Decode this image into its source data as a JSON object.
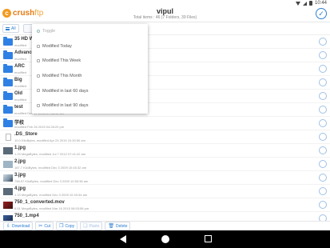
{
  "status_bar": {
    "time": "10:44"
  },
  "header": {
    "logo": {
      "letter": "c",
      "brand": "crush",
      "brand_tail": "ftp"
    },
    "title": "vipul",
    "subtitle": "Total items : 46 (7 Folders, 39 Files)"
  },
  "toolbar": {
    "filter_label": "All"
  },
  "dropdown": {
    "items": [
      {
        "label": "Toggle",
        "kind": "toggle"
      },
      {
        "label": "Modified Today",
        "kind": "option"
      },
      {
        "label": "Modified This Week",
        "kind": "option"
      },
      {
        "label": "Modified This Month",
        "kind": "option"
      },
      {
        "label": "Modified in last 60 days",
        "kind": "option"
      },
      {
        "label": "Modified in last 90 days",
        "kind": "option"
      }
    ]
  },
  "files": [
    {
      "name": "35 HD W",
      "meta": "modified",
      "thumb": "folder"
    },
    {
      "name": "Advance",
      "meta": "modified",
      "thumb": "folder"
    },
    {
      "name": "ARC",
      "meta": "modified",
      "thumb": "folder"
    },
    {
      "name": "Big",
      "meta": "modified",
      "thumb": "folder"
    },
    {
      "name": "Old",
      "meta": "modified",
      "thumb": "folder"
    },
    {
      "name": "test",
      "meta": "modified Dec 17 2015 07:56:42 am",
      "thumb": "folder"
    },
    {
      "name": "学校",
      "meta": "modified Feb 26 2015 04:28:20 pm",
      "thumb": "folder"
    },
    {
      "name": ".DS_Store",
      "meta": "10.0 KiloBytes, modified Apr 24 2015 10:30:50 am",
      "thumb": "doc"
    },
    {
      "name": "1.jpg",
      "meta": "1.23 MegaBytes, modified Jul 7 2012 07:41:42 am",
      "thumb": "img-dark"
    },
    {
      "name": "2.jpg",
      "meta": "187.7 KiloBytes, modified Dec 3 2009 10:45:32 am",
      "thumb": "img-light"
    },
    {
      "name": "3.jpg",
      "meta": "758.97 KiloBytes, modified Dec 3 2009 10:55:38 am",
      "thumb": "img-mixed"
    },
    {
      "name": "4.jpg",
      "meta": "1.13 MegaBytes, modified Dec 3 2009 10:49:34 am",
      "thumb": "img-dark"
    },
    {
      "name": "750_1_converted.mov",
      "meta": "6.51 MegaBytes, modified Mar 16 2015 08:53:58 pm",
      "thumb": "img-red"
    },
    {
      "name": "750_1.mp4",
      "meta": "",
      "thumb": "img-blue"
    }
  ],
  "actions": [
    {
      "label": "Download",
      "glyph": "⇩",
      "enabled": true
    },
    {
      "label": "Cut",
      "glyph": "✂",
      "enabled": true
    },
    {
      "label": "Copy",
      "glyph": "❐",
      "enabled": true
    },
    {
      "label": "Paste",
      "glyph": "❏",
      "enabled": false
    },
    {
      "label": "Delete",
      "glyph": "🗑",
      "enabled": true
    }
  ]
}
